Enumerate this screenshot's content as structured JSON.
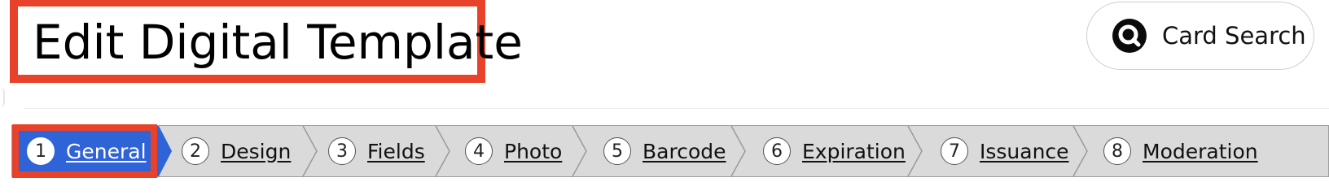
{
  "page": {
    "title": "Edit Digital Template"
  },
  "header": {
    "card_search": {
      "label": "Card Search",
      "icon": "search-icon"
    }
  },
  "steps": {
    "active_index": 0,
    "items": [
      {
        "number": "1",
        "label": "General"
      },
      {
        "number": "2",
        "label": "Design"
      },
      {
        "number": "3",
        "label": "Fields"
      },
      {
        "number": "4",
        "label": "Photo"
      },
      {
        "number": "5",
        "label": "Barcode"
      },
      {
        "number": "6",
        "label": "Expiration"
      },
      {
        "number": "7",
        "label": "Issuance"
      },
      {
        "number": "8",
        "label": "Moderation"
      }
    ]
  },
  "colors": {
    "active_step": "#2f63d8",
    "highlight": "#e8432a",
    "bar_bg": "#dadada",
    "separator": "#9a9a9a"
  }
}
